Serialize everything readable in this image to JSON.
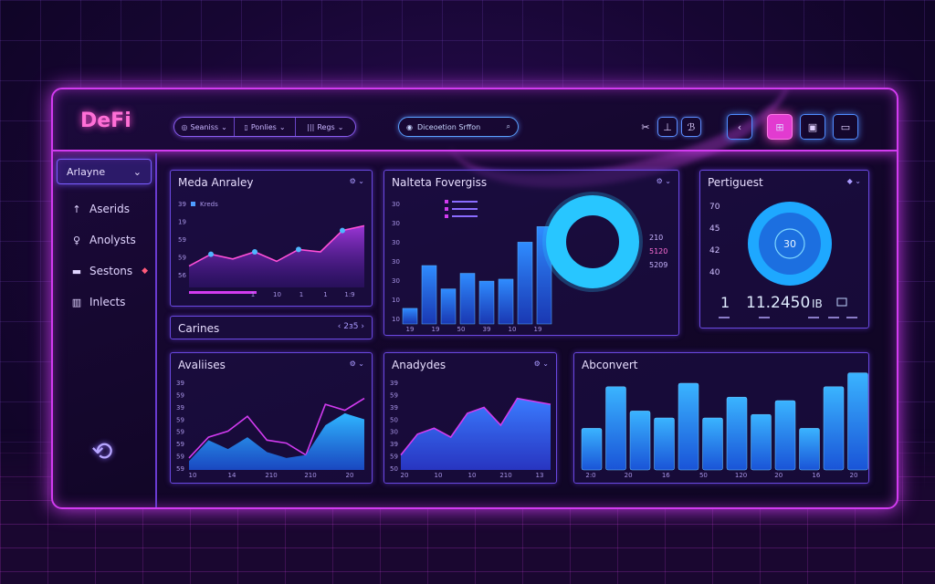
{
  "app": {
    "logo": "DeFi"
  },
  "toolbar": {
    "pills": [
      {
        "icon": "◎",
        "label": "Seaniss"
      },
      {
        "icon": "▯",
        "label": "Ponlies"
      },
      {
        "icon": "|||",
        "label": "Regs"
      }
    ],
    "search_placeholder": "Diceoetion Srffon",
    "icons": [
      "tools-icon",
      "pointer-icon",
      "layers-icon",
      "back-icon",
      "chart-icon",
      "document-icon",
      "wallet-icon"
    ],
    "active_color": "#e23bd0"
  },
  "sidebar": {
    "header": "Arlayne",
    "items": [
      {
        "icon": "↑",
        "label": "Aserids"
      },
      {
        "icon": "♀",
        "label": "Anolysts"
      },
      {
        "icon": "▬",
        "label": "Sestons"
      },
      {
        "icon": "▥",
        "label": "Inlects"
      }
    ]
  },
  "panels": {
    "media_analysis": {
      "title": "Meda Anraley",
      "legend": "Kreds",
      "y_ticks": [
        "39",
        "19",
        "59",
        "59",
        "56"
      ],
      "x_ticks": [
        "1",
        "10",
        "1",
        "1",
        "1:9"
      ],
      "chart_data": {
        "type": "line",
        "x": [
          0,
          1,
          2,
          3,
          4,
          5,
          6,
          7,
          8
        ],
        "values": [
          18,
          28,
          24,
          30,
          22,
          32,
          30,
          48,
          52
        ],
        "ylim": [
          0,
          60
        ]
      }
    },
    "candles": {
      "title": "Carines",
      "value": "2ɜ5"
    },
    "markets": {
      "title": "Nalteta Fovergiss",
      "y_ticks": [
        "30",
        "30",
        "30",
        "30",
        "30",
        "10",
        "10"
      ],
      "x_ticks": [
        "19",
        "19",
        "50",
        "39",
        "10",
        "19"
      ],
      "donut_labels": [
        "210",
        "5120",
        "5209"
      ],
      "chart_data": {
        "type": "bar",
        "values": [
          8,
          30,
          18,
          26,
          22,
          23,
          42,
          50
        ],
        "ylim": [
          0,
          60
        ]
      }
    },
    "portfolio": {
      "title": "Pertiguest",
      "y_ticks": [
        "70",
        "45",
        "42",
        "40"
      ],
      "center_value": "30",
      "big_number": "11.2450",
      "left_number": "1",
      "suffix": "IB"
    },
    "analyses": {
      "title": "Avaliises",
      "y_ticks": [
        "39",
        "59",
        "39",
        "59",
        "59",
        "59",
        "59",
        "59"
      ],
      "x_ticks": [
        "10",
        "14",
        "210",
        "210",
        "20"
      ],
      "chart_data": {
        "type": "area",
        "series": [
          {
            "values": [
              6,
              20,
              14,
              22,
              12,
              8,
              10,
              30,
              38,
              34
            ]
          },
          {
            "values": [
              8,
              22,
              26,
              36,
              20,
              18,
              10,
              44,
              40,
              48
            ]
          }
        ],
        "ylim": [
          0,
          60
        ]
      }
    },
    "analydes": {
      "title": "Anadydes",
      "y_ticks": [
        "39",
        "59",
        "39",
        "50",
        "30",
        "39",
        "59",
        "50"
      ],
      "x_ticks": [
        "20",
        "10",
        "10",
        "210",
        "13"
      ],
      "chart_data": {
        "type": "area",
        "values": [
          10,
          24,
          28,
          22,
          38,
          42,
          30,
          48,
          46,
          44
        ],
        "ylim": [
          0,
          60
        ]
      }
    },
    "abconvert": {
      "title": "Abconvert",
      "x_ticks": [
        "2:0",
        "20",
        "16",
        "50",
        "120",
        "20",
        "16",
        "20"
      ],
      "chart_data": {
        "type": "bar",
        "values": [
          24,
          48,
          34,
          30,
          50,
          30,
          42,
          32,
          40,
          24,
          48,
          56
        ],
        "ylim": [
          0,
          60
        ]
      }
    }
  }
}
